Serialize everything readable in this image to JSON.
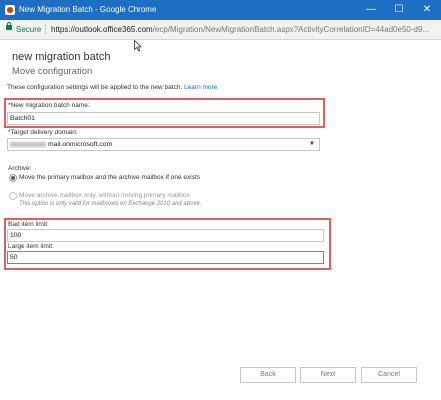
{
  "window": {
    "title": "New Migration Batch - Google Chrome",
    "controls": {
      "minimize": "—",
      "maximize": "☐",
      "close": "✕"
    }
  },
  "addressbar": {
    "secure_label": "Secure",
    "url_host": "https://outlook.office365.com",
    "url_path": "/ecp/Migration/NewMigrationBatch.aspx?ActivityCorrelationID=44ad0e50-d9..."
  },
  "page": {
    "title": "new migration batch",
    "subtitle": "Move configuration",
    "intro_text": "These configuration settings will be applied to the new batch.",
    "learn_more": "Learn more"
  },
  "form": {
    "batch_name_label": "*New migration batch name:",
    "batch_name_value": "Batch01",
    "delivery_domain_label": "*Target delivery domain:",
    "delivery_domain_value": "mail.onmicrosoft.com",
    "archive_label": "Archive:",
    "archive_option_1": "Move the primary mailbox and the archive mailbox if one exists",
    "archive_option_2": "Move archive mailbox only, without moving primary mailbox",
    "archive_option_2_note": "This option is only valid for mailboxes on Exchange 2010 and above.",
    "bad_item_label": "Bad item limit:",
    "bad_item_value": "100",
    "large_item_label": "Large item limit:",
    "large_item_value": "50"
  },
  "footer": {
    "back": "Back",
    "next": "Next",
    "cancel": "Cancel"
  },
  "colors": {
    "titlebar": "#1e6fc4",
    "highlight": "#e06060",
    "link": "#0072c6",
    "secure": "#0b8043"
  }
}
